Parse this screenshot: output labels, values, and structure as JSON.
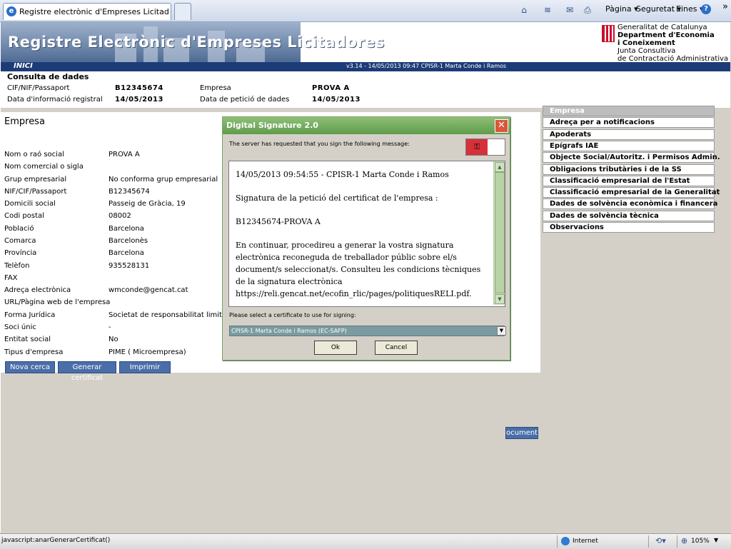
{
  "browser": {
    "tab_title": "Registre electrònic d'Empreses Licitadores.Consulta A...",
    "commands": {
      "pagina": "Pàgina ▾",
      "seguretat": "Seguretat ▾",
      "eines": "Eines ▾",
      "more": "»"
    },
    "status": {
      "url": "javascript:anarGenerarCertificat()",
      "zone": "Internet",
      "zoom": "105%"
    }
  },
  "header": {
    "title": "Registre Electrònic d'Empreses Licitadores",
    "gencat_lines": [
      "Generalitat de Catalunya",
      "Department d'Economia",
      "i Coneixement",
      "Junta Consultiva",
      "de Contractació Administrativa"
    ],
    "inici": "INICI",
    "version": "v3.14 - 14/05/2013 09:47 CPISR-1 Marta Conde i Ramos"
  },
  "consulta": {
    "title": "Consulta de dades",
    "cif_label": "CIF/NIF/Passaport",
    "cif_value": "B12345674",
    "empresa_label": "Empresa",
    "empresa_value": "PROVA A",
    "data_info_label": "Data d'informació registral",
    "data_info_value": "14/05/2013",
    "data_peticio_label": "Data de petició de dades",
    "data_peticio_value": "14/05/2013"
  },
  "empresa": {
    "title": "Empresa",
    "rows": [
      {
        "label": "Nom o raó social",
        "value": "PROVA A"
      },
      {
        "label": "Nom comercial o sigla",
        "value": ""
      },
      {
        "label": "Grup empresarial",
        "value": "No conforma grup empresarial"
      },
      {
        "label": "NIF/CIF/Passaport",
        "value": "B12345674"
      },
      {
        "label": "Domicili social",
        "value": "Passeig de Gràcia, 19"
      },
      {
        "label": "Codi postal",
        "value": "08002"
      },
      {
        "label": "Població",
        "value": "Barcelona"
      },
      {
        "label": "Comarca",
        "value": "Barcelonès"
      },
      {
        "label": "Província",
        "value": "Barcelona"
      },
      {
        "label": "Telèfon",
        "value": "935528131"
      },
      {
        "label": "FAX",
        "value": ""
      },
      {
        "label": "Adreça electrònica",
        "value": "wmconde@gencat.cat"
      },
      {
        "label": "URL/Pàgina web de l'empresa",
        "value": ""
      },
      {
        "label": "Forma Jurídica",
        "value": "Societat de responsabilitat limitada"
      },
      {
        "label": "Soci únic",
        "value": "-"
      },
      {
        "label": "Entitat social",
        "value": "No"
      },
      {
        "label": "Tipus d'empresa",
        "value": "PIME ( Microempresa)"
      }
    ]
  },
  "menu": [
    "Empresa",
    "Adreça per a notificacions",
    "Apoderats",
    "Epígrafs IAE",
    "Objecte Social/Autoritz. i Permisos Admin.",
    "Obligacions tributàries i de la SS",
    "Classificació empresarial de l'Estat",
    "Classificació empresarial de la Generalitat",
    "Dades de solvència econòmica i financera",
    "Dades de solvència tècnica",
    "Observacions"
  ],
  "buttons": {
    "nova_cerca": "Nova cerca",
    "generar_certificat": "Generar certificat",
    "imprimir": "Imprimir",
    "documents": "ocuments"
  },
  "dialog": {
    "title": "Digital Signature 2.0",
    "close": "✕",
    "message": "The server has requested that you sign the following message:",
    "sign_text": [
      "14/05/2013 09:54:55 - CPISR-1 Marta Conde i Ramos",
      "Signatura de la petició del certificat de l'empresa :",
      "B12345674-PROVA A",
      "En continuar, procedireu a generar la vostra signatura electrònica reconeguda de treballador públic sobre el/s document/s seleccionat/s. Consulteu les condicions tècniques de la signatura electrònica https://reli.gencat.net/ecofin_rlic/pages/politiquesRELI.pdf."
    ],
    "cert_label": "Please select a certificate to use for signing:",
    "cert_selected": "CPISR-1 Marta Conde i Ramos (EC-SAFP)",
    "ok": "Ok",
    "cancel": "Cancel"
  },
  "colors": {
    "navy": "#1c3c78",
    "button_blue": "#4a6ea8",
    "dialog_green": "#5f9b4b",
    "key_red": "#d6313a"
  }
}
